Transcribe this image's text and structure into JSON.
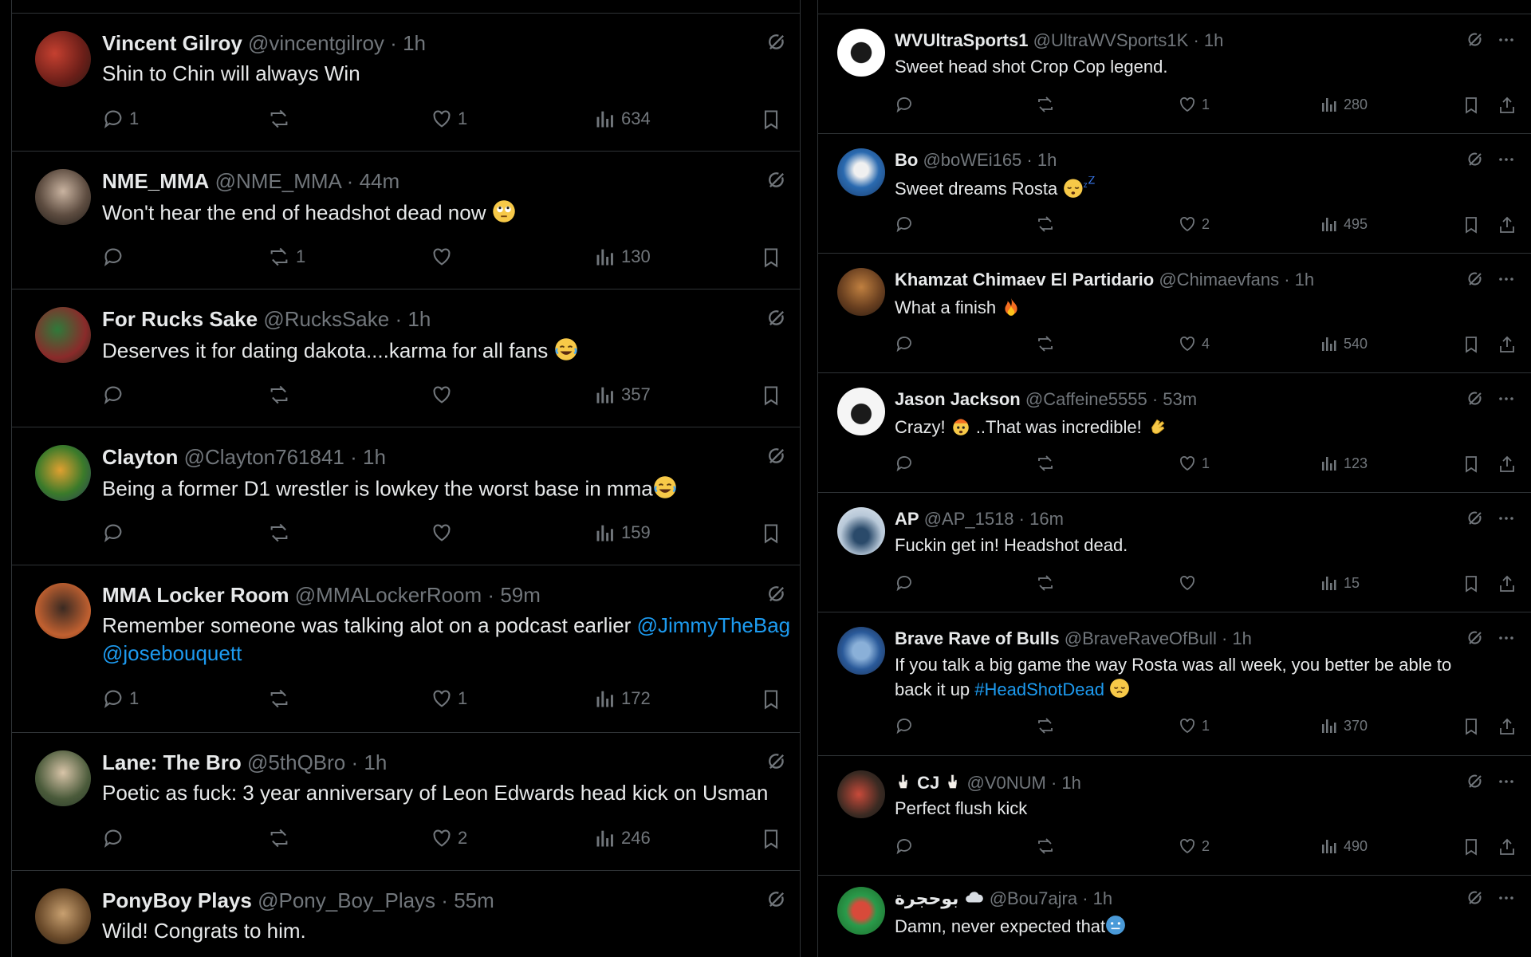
{
  "left_column": {
    "tweets": [
      {
        "name": "Vincent Gilroy",
        "handle": "@vincentgilroy",
        "time": "1h",
        "text": "Shin to Chin will always Win",
        "replies": "1",
        "reposts": "",
        "likes": "1",
        "views": "634"
      },
      {
        "name": "NME_MMA",
        "handle": "@NME_MMA",
        "time": "44m",
        "text": "Won't hear the end of headshot dead now",
        "replies": "",
        "reposts": "1",
        "likes": "",
        "views": "130"
      },
      {
        "name": "For Rucks Sake",
        "handle": "@RucksSake",
        "time": "1h",
        "text": "Deserves it for dating dakota....karma for all fans",
        "replies": "",
        "reposts": "",
        "likes": "",
        "views": "357"
      },
      {
        "name": "Clayton",
        "handle": "@Clayton761841",
        "time": "1h",
        "text": "Being a former D1 wrestler is lowkey the worst base in mma",
        "replies": "",
        "reposts": "",
        "likes": "",
        "views": "159"
      },
      {
        "name": "MMA Locker Room",
        "handle": "@MMALockerRoom",
        "time": "59m",
        "text": "Remember someone was talking alot on a podcast earlier",
        "link1": "@JimmyTheBag",
        "link2": "@josebouquett",
        "replies": "1",
        "reposts": "",
        "likes": "1",
        "views": "172"
      },
      {
        "name": "Lane: The Bro",
        "handle": "@5thQBro",
        "time": "1h",
        "text": "Poetic as fuck: 3 year anniversary of Leon Edwards head kick on Usman",
        "replies": "",
        "reposts": "",
        "likes": "2",
        "views": "246"
      },
      {
        "name": "PonyBoy Plays",
        "handle": "@Pony_Boy_Plays",
        "time": "55m",
        "text": "Wild! Congrats to him."
      }
    ]
  },
  "right_column": {
    "tweets": [
      {
        "name": "WVUltraSports1",
        "handle": "@UltraWVSports1K",
        "time": "1h",
        "text": "Sweet head shot Crop Cop legend.",
        "likes": "1",
        "views": "280"
      },
      {
        "name": "Bo",
        "handle": "@boWEi165",
        "time": "1h",
        "text": "Sweet dreams Rosta",
        "likes": "2",
        "views": "495"
      },
      {
        "name": "Khamzat Chimaev El Partidario",
        "handle": "@Chimaevfans",
        "time": "1h",
        "text": "What a finish",
        "likes": "4",
        "views": "540"
      },
      {
        "name": "Jason Jackson",
        "handle": "@Caffeine5555",
        "time": "53m",
        "text": "Crazy!",
        "text2": "..That was incredible!",
        "likes": "1",
        "views": "123"
      },
      {
        "name": "AP",
        "handle": "@AP_1518",
        "time": "16m",
        "text": "Fuckin get in! Headshot dead.",
        "likes": "",
        "views": "15"
      },
      {
        "name": "Brave Rave of Bulls",
        "handle": "@BraveRaveOfBull",
        "time": "1h",
        "text": "If you talk a big game the way Rosta was all week, you better be able to",
        "text2": "back it up",
        "hashtag": "#HeadShotDead",
        "likes": "1",
        "views": "370"
      },
      {
        "name": "CJ",
        "handle": "@V0NUM",
        "time": "1h",
        "text": "Perfect flush kick",
        "likes": "2",
        "views": "490"
      },
      {
        "name": "بوحجرة",
        "handle": "@Bou7ajra",
        "time": "1h",
        "text": "Damn, never expected that"
      }
    ]
  },
  "separator": "·",
  "icons": {
    "reply": "reply-icon",
    "repost": "repost-icon",
    "like": "heart-icon",
    "views": "views-icon",
    "bookmark": "bookmark-icon",
    "share": "share-icon",
    "grok": "grok-icon",
    "more": "more-icon"
  },
  "colors": {
    "background": "#000000",
    "text": "#e7e9ea",
    "muted": "#71767b",
    "link": "#1d9bf0",
    "border": "#2f3336"
  }
}
